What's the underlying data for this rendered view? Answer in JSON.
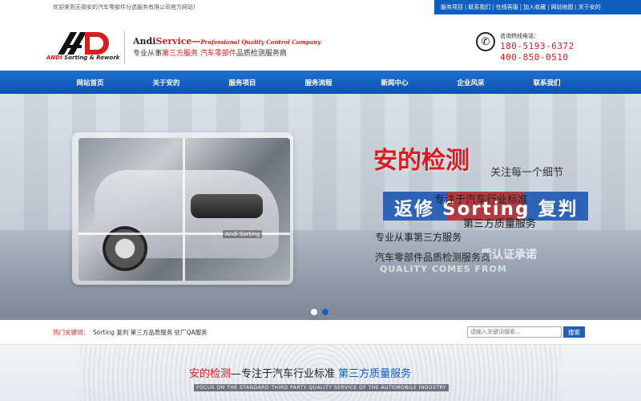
{
  "topbar": {
    "welcome": "欢迎来到无锡安的汽车零部件分选服务有限公司官方网站！",
    "links": [
      "服务项目",
      "联系我们",
      "在线客服",
      "加入收藏",
      "网站地图",
      "关于安的"
    ]
  },
  "header": {
    "logo_text_red": "ANDI",
    "logo_text_rest": " Sorting & Rework",
    "brand_name": "Andi",
    "brand_service": "Service",
    "brand_dash": "—",
    "brand_tagline": "Professional Quality Control Company",
    "slogan_pre": "专业从事",
    "slogan_red1": "第三方服务",
    "slogan_mid": " ",
    "slogan_red2": "汽车零部件",
    "slogan_post": "品质检测服务商",
    "hotline_title": "咨询热线电话：",
    "hotline_1": "180-5193-6372",
    "hotline_2": "400-850-0510"
  },
  "nav": {
    "items": [
      "网站首页",
      "关于安的",
      "服务项目",
      "服务流程",
      "新闻中心",
      "企业风采",
      "联系我们"
    ]
  },
  "banner": {
    "title": "安的检测",
    "sub1": "关注每一个细节",
    "box_text": "返修 Sorting 复判",
    "over1": "专注于汽车行业标准",
    "over2": "第三方质量服务",
    "line1": "专业从事第三方服务",
    "line2": "汽车零部件品质检测服务商",
    "ghost": "质认证承诺",
    "en": "QUALITY COMES  FROM",
    "photo_label": "Andi Sorting",
    "slides": 2,
    "active_slide": 2
  },
  "hotbar": {
    "label": "热门关键词：",
    "keywords": "Sorting 复判 第三方品质服务 驻厂QA服务",
    "search_placeholder": "请输入关键词搜索...",
    "search_button": "搜索"
  },
  "section": {
    "title_red": "安的检测",
    "title_mid": "—专注于汽车行业标准 ",
    "title_blue": "第三方质量服务",
    "subtitle_en": "FOCUS ON THE STANDARD THIRD PARTY QUALITY SERVICE OF THE AUTOMOBILE INDUSTRY"
  },
  "colors": {
    "brand_blue": "#0e5fbf",
    "brand_red": "#d71d1d"
  }
}
